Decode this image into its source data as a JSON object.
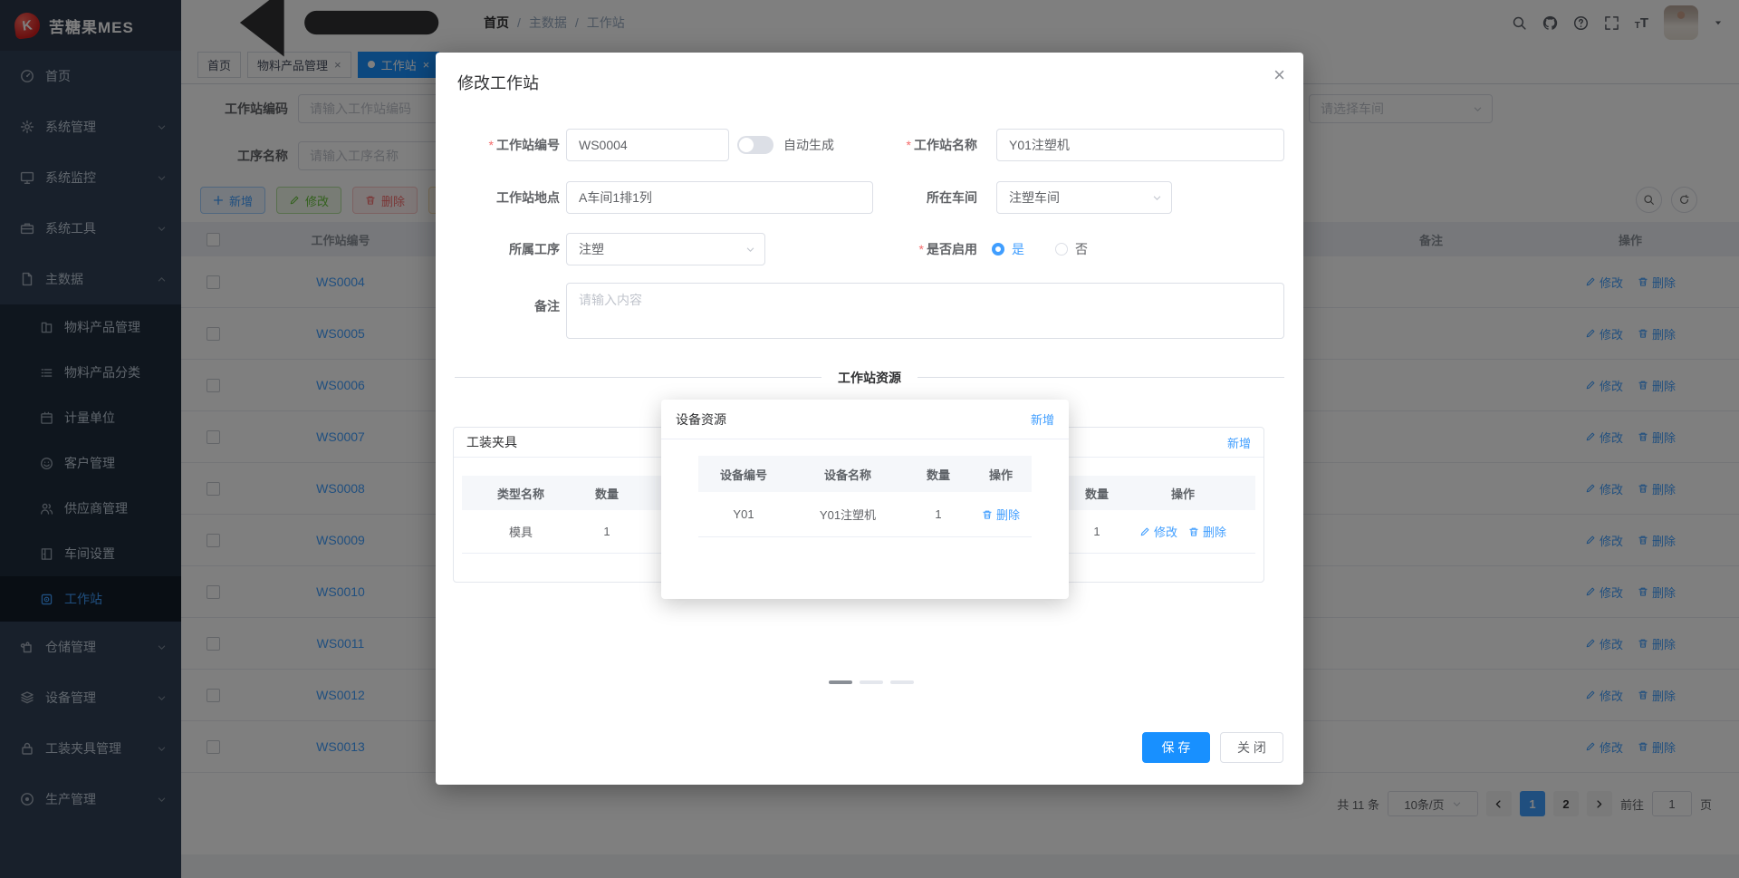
{
  "app": {
    "logo_text": "苦糖果MES",
    "logo_letter": "K"
  },
  "ui": {
    "close_char": "×",
    "required_mark": "*",
    "breadcrumb_separator": "/"
  },
  "colors": {
    "primary": "#409eff",
    "tab_active": "#1890ff",
    "success": "#67c23a",
    "danger": "#f56c6c",
    "warning": "#e6a23c"
  },
  "sidebar": {
    "top": [
      {
        "label": "首页"
      },
      {
        "label": "系统管理"
      },
      {
        "label": "系统监控"
      },
      {
        "label": "系统工具"
      },
      {
        "label": "主数据"
      }
    ],
    "sub": [
      {
        "label": "物料产品管理"
      },
      {
        "label": "物料产品分类"
      },
      {
        "label": "计量单位"
      },
      {
        "label": "客户管理"
      },
      {
        "label": "供应商管理"
      },
      {
        "label": "车间设置"
      },
      {
        "label": "工作站"
      }
    ],
    "bottom": [
      {
        "label": "仓储管理"
      },
      {
        "label": "设备管理"
      },
      {
        "label": "工装夹具管理"
      },
      {
        "label": "生产管理"
      }
    ]
  },
  "header": {
    "breadcrumb": [
      "首页",
      "主数据",
      "工作站"
    ]
  },
  "tabs": {
    "items": [
      {
        "label": "首页"
      },
      {
        "label": "物料产品管理"
      },
      {
        "label": "工作站"
      }
    ]
  },
  "filters": {
    "code_label": "工作站编码",
    "code_placeholder": "请输入工作站编码",
    "process_label": "工序名称",
    "process_placeholder": "请输入工序名称",
    "workshop_placeholder": "请选择车间"
  },
  "toolbar": {
    "add": "新增",
    "edit": "修改",
    "del": "删除"
  },
  "table": {
    "col_code": "工作站编号",
    "col_remark": "备注",
    "col_ops": "操作",
    "action_edit": "修改",
    "action_delete": "删除",
    "rows": [
      {
        "code": "WS0004"
      },
      {
        "code": "WS0005"
      },
      {
        "code": "WS0006"
      },
      {
        "code": "WS0007"
      },
      {
        "code": "WS0008"
      },
      {
        "code": "WS0009"
      },
      {
        "code": "WS0010"
      },
      {
        "code": "WS0011"
      },
      {
        "code": "WS0012"
      },
      {
        "code": "WS0013"
      }
    ]
  },
  "pagination": {
    "total": "共 11 条",
    "page_size": "10条/页",
    "page1": "1",
    "page2": "2",
    "goto_label": "前往",
    "goto_value": "1",
    "page_unit": "页"
  },
  "modal": {
    "title": "修改工作站",
    "fields": {
      "code_label": "工作站编号",
      "code_value": "WS0004",
      "auto_generate": "自动生成",
      "name_label": "工作站名称",
      "name_value": "Y01注塑机",
      "location_label": "工作站地点",
      "location_value": "A车间1排1列",
      "workshop_label": "所在车间",
      "workshop_value": "注塑车间",
      "process_label": "所属工序",
      "process_value": "注塑",
      "enabled_label": "是否启用",
      "enabled_yes": "是",
      "enabled_no": "否",
      "remark_label": "备注",
      "remark_placeholder": "请输入内容"
    },
    "divider": "工作站资源",
    "add_label": "新增",
    "action_edit": "修改",
    "action_delete": "删除",
    "fixture_card": {
      "title": "工装夹具",
      "col_type": "类型名称",
      "col_qty": "数量",
      "col_ops": "操作",
      "row": {
        "type": "模具",
        "qty": "1"
      }
    },
    "right_card": {
      "col_qty": "数量",
      "col_ops": "操作",
      "row": {
        "qty": "1"
      }
    },
    "device_popup": {
      "title": "设备资源",
      "col_code": "设备编号",
      "col_name": "设备名称",
      "col_qty": "数量",
      "col_ops": "操作",
      "row": {
        "code": "Y01",
        "name": "Y01注塑机",
        "qty": "1"
      }
    },
    "save": "保 存",
    "close": "关 闭"
  }
}
